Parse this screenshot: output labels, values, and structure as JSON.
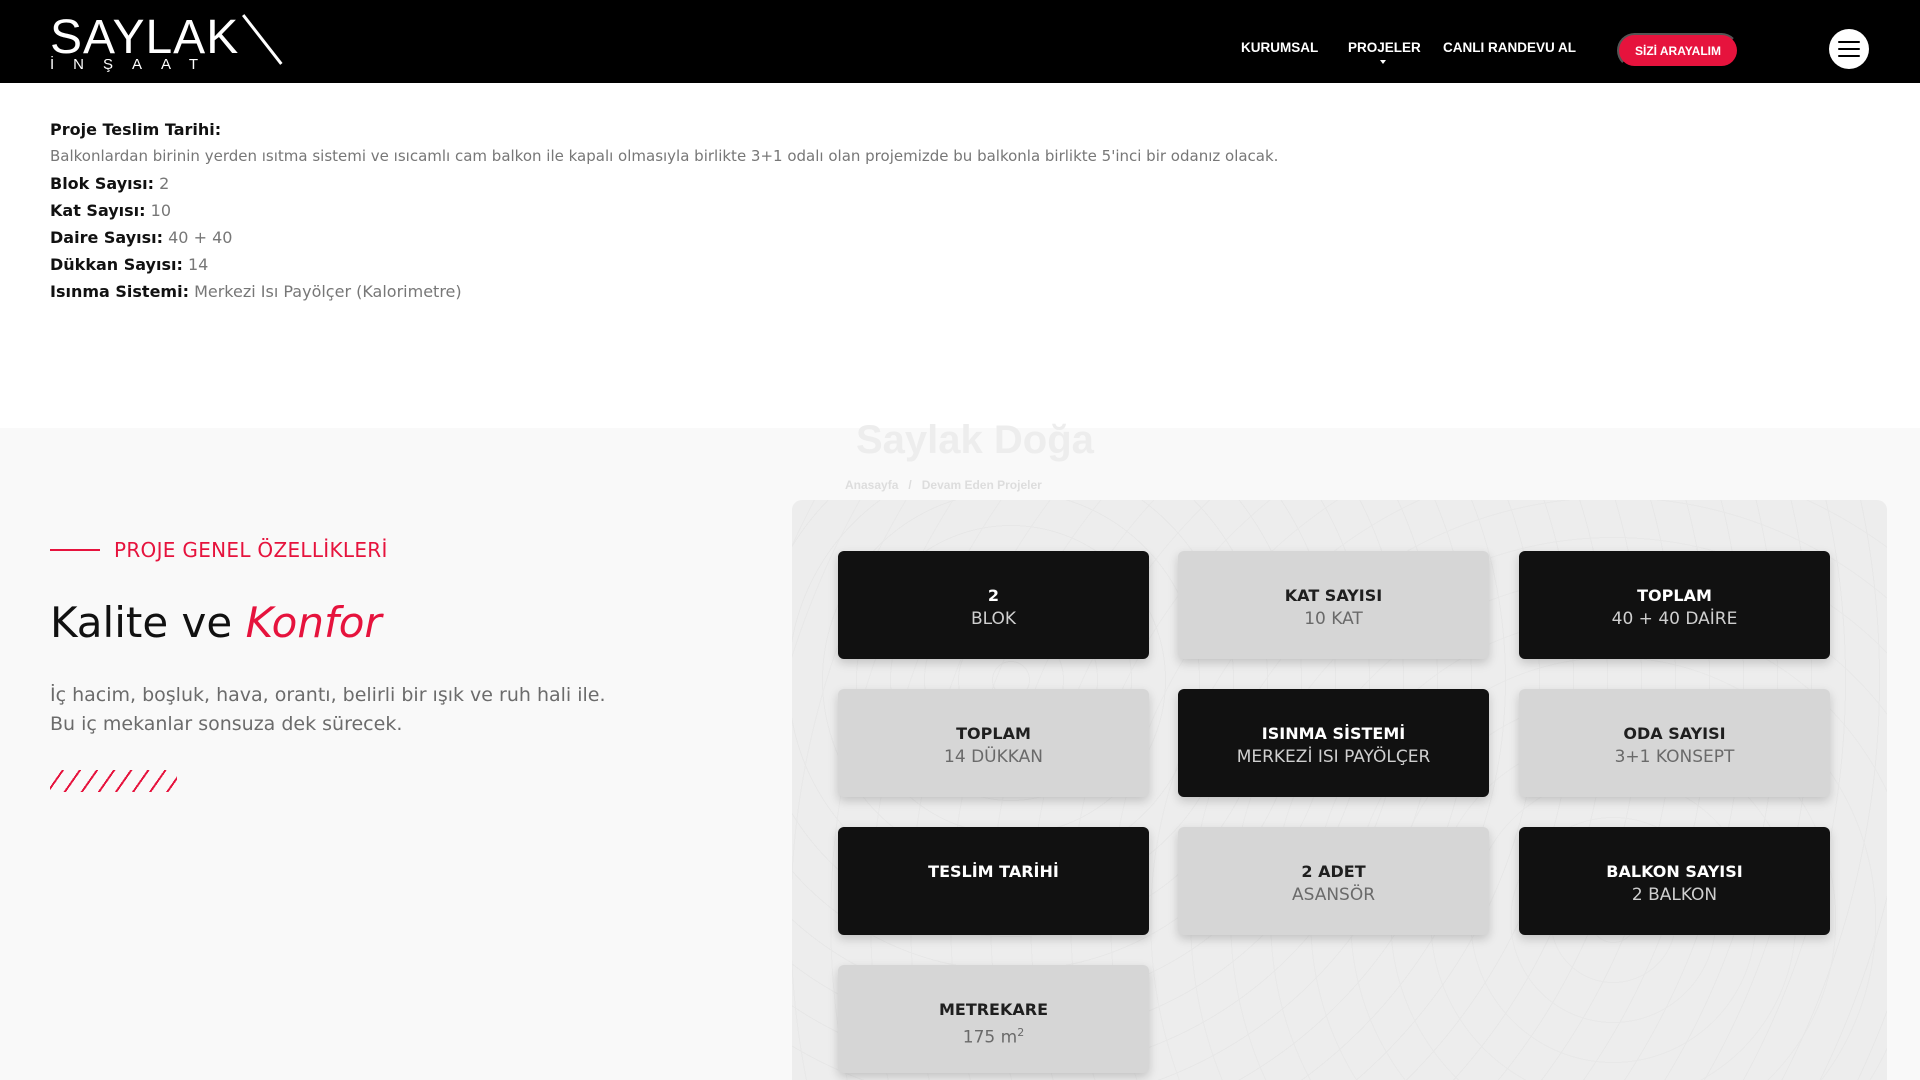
{
  "header": {
    "logo_main": "SAYLAK",
    "logo_sub": "İNŞAAT",
    "nav": [
      "KURUMSAL",
      "PROJELER",
      "CANLI RANDEVU AL"
    ],
    "cta": "SİZİ ARAYALIM",
    "menu_icon": "hamburger-icon"
  },
  "info": {
    "delivery_label": "Proje Teslim Tarihi:",
    "description": "Balkonlardan birinin yerden ısıtma sistemi ve ısıcamlı cam balkon ile kapalı olmasıyla birlikte 3+1 odalı olan projemizde bu balkonla birlikte 5'inci bir odanız olacak.",
    "items": [
      {
        "label": "Blok Sayısı:",
        "value": "2"
      },
      {
        "label": "Kat Sayısı:",
        "value": "10"
      },
      {
        "label": "Daire Sayısı:",
        "value": "40 + 40"
      },
      {
        "label": "Dükkan Sayısı:",
        "value": "14"
      },
      {
        "label": "Isınma Sistemi:",
        "value": "Merkezi Isı Payölçer (Kalorimetre)"
      }
    ]
  },
  "ghost": {
    "title": "Saylak Doğa",
    "crumb_home": "Anasayfa",
    "crumb_sep": "/",
    "crumb_current": "Devam Eden Projeler"
  },
  "features": {
    "eyebrow": "PROJE GENEL ÖZELLİKLERİ",
    "headline_plain": "Kalite ve",
    "headline_accent": "Konfor",
    "lead": "İç hacim, boşluk, hava, orantı, belirli bir ışık ve ruh hali ile. Bu iç mekanlar sonsuza dek sürecek.",
    "cards": [
      {
        "title": "2",
        "sub": "BLOK"
      },
      {
        "title": "KAT SAYISI",
        "sub": "10 KAT"
      },
      {
        "title": "TOPLAM",
        "sub": "40 + 40 DAİRE"
      },
      {
        "title": "TOPLAM",
        "sub": "14 DÜKKAN"
      },
      {
        "title": "ISINMA SİSTEMİ",
        "sub": "MERKEZİ ISI PAYÖLÇER"
      },
      {
        "title": "ODA SAYISI",
        "sub": "3+1 KONSEPT"
      },
      {
        "title": "TESLİM TARİHİ",
        "sub": ""
      },
      {
        "title": "2 ADET",
        "sub": "ASANSÖR"
      },
      {
        "title": "BALKON SAYISI",
        "sub": "2 BALKON"
      },
      {
        "title": "METREKARE",
        "sub": "175 m",
        "sup": "2"
      }
    ]
  },
  "colors": {
    "accent": "#e6133d",
    "header_bg": "#000000",
    "card_dark": "#111111",
    "card_light": "#d6d6d6"
  }
}
